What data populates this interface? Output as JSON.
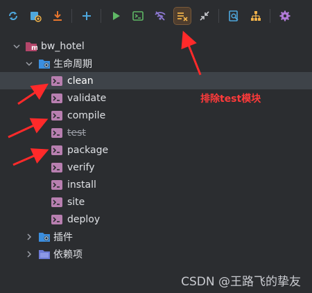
{
  "toolbar": {
    "buttons": [
      {
        "name": "reload-icon",
        "color": "#4ea8de"
      },
      {
        "name": "add-maven-project-icon",
        "color": "#4ea8de"
      },
      {
        "name": "download-sources-icon",
        "color": "#e8762d"
      },
      {
        "name": "add-icon",
        "color": "#4ea8de"
      },
      {
        "name": "run-icon",
        "color": "#5fb865"
      },
      {
        "name": "execute-goal-icon",
        "color": "#5fb865"
      },
      {
        "name": "toggle-offline-icon",
        "color": "#8f7ad6"
      },
      {
        "name": "skip-tests-icon",
        "color": "#f0b24a"
      },
      {
        "name": "collapse-all-icon",
        "color": "#c9cbd0"
      },
      {
        "name": "analyze-dependencies-icon",
        "color": "#4ea8de"
      },
      {
        "name": "show-diagram-icon",
        "color": "#f0b24a"
      },
      {
        "name": "settings-icon",
        "color": "#b07ad6"
      }
    ]
  },
  "tree": {
    "project": "bw_hotel",
    "lifecycle": "生命周期",
    "goals": [
      "clean",
      "validate",
      "compile",
      "test",
      "package",
      "verify",
      "install",
      "site",
      "deploy"
    ],
    "plugins": "插件",
    "dependencies": "依赖项"
  },
  "annotation": "排除test模块",
  "watermark": "CSDN @王路飞的挚友",
  "colors": {
    "background": "#2b2d30",
    "selection": "#3e4349",
    "annotation": "#ff3a3a",
    "goal_icon": "#b87fb0",
    "folder_blue": "#3b8ede"
  }
}
